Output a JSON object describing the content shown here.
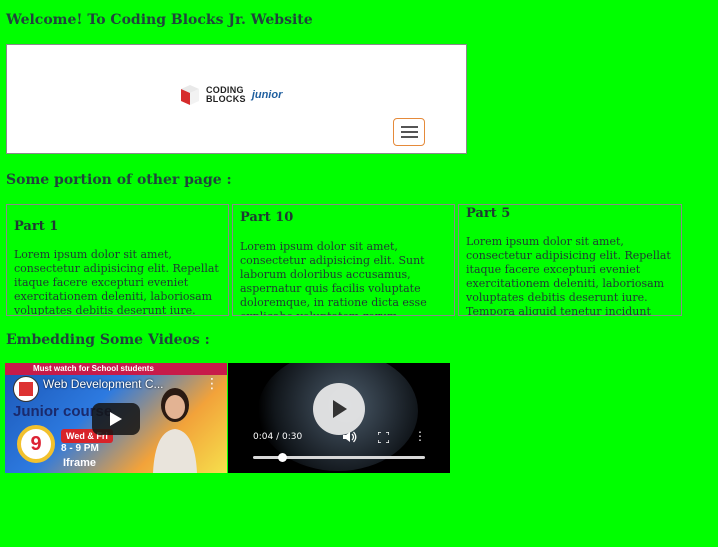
{
  "page": {
    "welcome_heading": "Welcome! To Coding Blocks Jr. Website",
    "portion_heading": "Some portion of other page :",
    "videos_heading": "Embedding Some Videos :"
  },
  "site_frame": {
    "logo_line1": "CODING",
    "logo_line2": "BLOCKS",
    "logo_junior": "junior",
    "menu_icon": "hamburger-menu-icon"
  },
  "parts": [
    {
      "title": "Part 1",
      "body": "Lorem ipsum dolor sit amet, consectetur adipisicing elit. Repellat itaque facere excepturi eveniet exercitationem deleniti, laboriosam voluptates debitis deserunt iure."
    },
    {
      "title": "Part 10",
      "body": "Lorem ipsum dolor sit amet, consectetur adipisicing elit. Sunt laborum doloribus accusamus, aspernatur quis facilis voluptate doloremque, in ratione dicta esse explicabo voluptatem rerum."
    },
    {
      "title": "Part 5",
      "body": "Lorem ipsum dolor sit amet, consectetur adipisicing elit. Repellat itaque facere excepturi eveniet exercitationem deleniti, laboriosam voluptates debitis deserunt iure. Tempora aliquid tenetur incidunt"
    }
  ],
  "videos": {
    "youtube": {
      "banner": "Must watch for School students",
      "title": "Web Development C...",
      "thumbnail_sub": "Junior course",
      "date_number": "9",
      "days": "Wed & Fri",
      "time": "8 - 9 PM",
      "footer_label": "Iframe"
    },
    "player": {
      "time_display": "0:04 / 0:30",
      "progress_fraction": 0.17
    }
  },
  "colors": {
    "background": "#00ff00",
    "text": "#1f3a33",
    "menu_border": "#e58a3a"
  }
}
